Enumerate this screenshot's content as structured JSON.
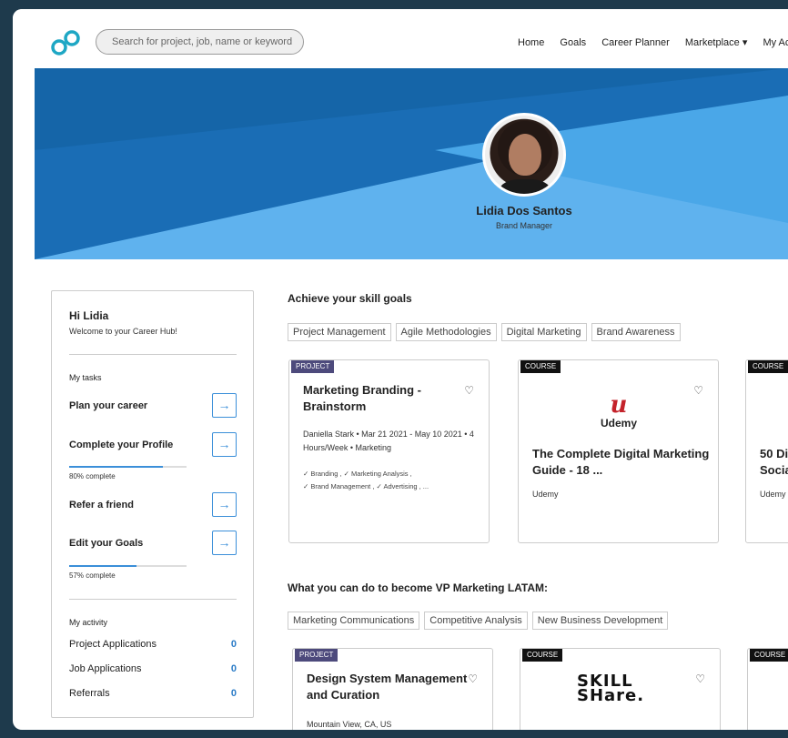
{
  "header": {
    "search_placeholder": "Search for project, job, name or keyword",
    "nav": [
      "Home",
      "Goals",
      "Career Planner",
      "Marketplace ▾",
      "My Ac"
    ]
  },
  "profile": {
    "name": "Lidia Dos Santos",
    "role": "Brand Manager"
  },
  "sidebar": {
    "greeting": "Hi Lidia",
    "welcome": "Welcome to your Career Hub!",
    "tasks_label": "My tasks",
    "tasks": [
      {
        "label": "Plan your career"
      },
      {
        "label": "Complete your Profile",
        "progress_text": "80% complete",
        "progress": 0.8
      },
      {
        "label": "Refer a friend"
      },
      {
        "label": "Edit your Goals",
        "progress_text": "57% complete",
        "progress": 0.57
      }
    ],
    "activity_label": "My activity",
    "activity": [
      {
        "label": "Project Applications",
        "value": "0"
      },
      {
        "label": "Job Applications",
        "value": "0"
      },
      {
        "label": "Referrals",
        "value": "0"
      }
    ]
  },
  "skills": {
    "title": "Achieve your skill goals",
    "chips": [
      "Project Management",
      "Agile Methodologies",
      "Digital Marketing",
      "Brand Awareness"
    ],
    "cards": [
      {
        "badge": "PROJECT",
        "title": "Marketing Branding - Brainstorm",
        "meta": "Daniella Stark • Mar 21 2021 - May 10 2021 • 4 Hours/Week • Marketing",
        "tags_line1": "✓ Branding , ✓ Marketing Analysis ,",
        "tags_line2": "✓ Brand Management , ✓ Advertising , ..."
      },
      {
        "badge": "COURSE",
        "logo_text": "Udemy",
        "title": "The Complete Digital Marketing Guide - 18 ...",
        "provider": "Udemy"
      },
      {
        "badge": "COURSE",
        "title": "50 Di Socia",
        "provider": "Udemy"
      }
    ]
  },
  "vp": {
    "title": "What you can do to become VP Marketing LATAM:",
    "chips": [
      "Marketing Communications",
      "Competitive Analysis",
      "New Business Development"
    ],
    "cards": [
      {
        "badge": "PROJECT",
        "title": "Design System Management and Curation",
        "meta": "Mountain View, CA, US"
      },
      {
        "badge": "COURSE",
        "logo_line1": "SKILL",
        "logo_line2": "SHare."
      },
      {
        "badge": "COURSE"
      }
    ]
  },
  "colors": {
    "hero_dark": "#1a6db5",
    "hero_light": "#5fb2ee",
    "accent": "#3b8fd9",
    "project_badge": "#4d4a7c"
  }
}
